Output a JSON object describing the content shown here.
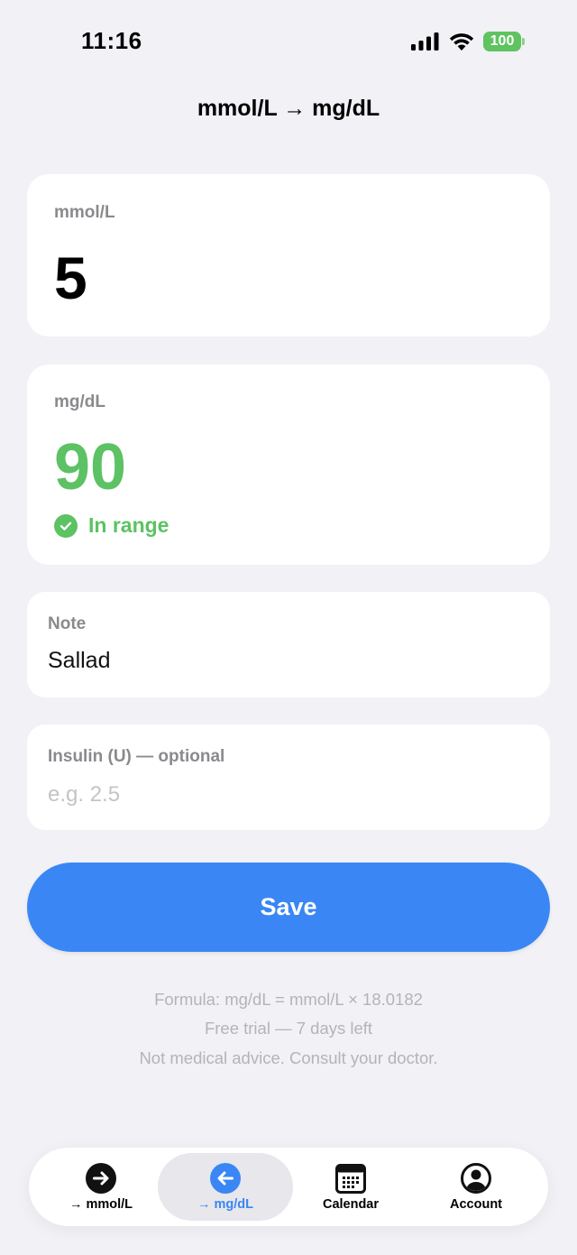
{
  "status": {
    "time": "11:16",
    "battery": "100"
  },
  "title": "mmol/L → mg/dL",
  "input_card": {
    "label": "mmol/L",
    "value": "5"
  },
  "result_card": {
    "label": "mg/dL",
    "value": "90",
    "status": "In range",
    "status_color": "#5CC263"
  },
  "note": {
    "label": "Note",
    "value": "Sallad"
  },
  "insulin": {
    "label": "Insulin (U) — optional",
    "placeholder": "e.g. 2.5"
  },
  "save_label": "Save",
  "footer": {
    "formula": "Formula: mg/dL = mmol/L × 18.0182",
    "trial": "Free trial — 7 days left",
    "disclaimer": "Not medical advice. Consult your doctor."
  },
  "tabs": [
    {
      "label": "→ mmol/L",
      "icon": "arrow-right-circle-icon",
      "active": false
    },
    {
      "label": "→ mg/dL",
      "icon": "arrow-left-circle-icon",
      "active": true
    },
    {
      "label": "Calendar",
      "icon": "calendar-icon",
      "active": false
    },
    {
      "label": "Account",
      "icon": "account-icon",
      "active": false
    }
  ],
  "colors": {
    "accent": "#3A86F4",
    "success": "#5CC263",
    "background": "#F1F1F6"
  }
}
